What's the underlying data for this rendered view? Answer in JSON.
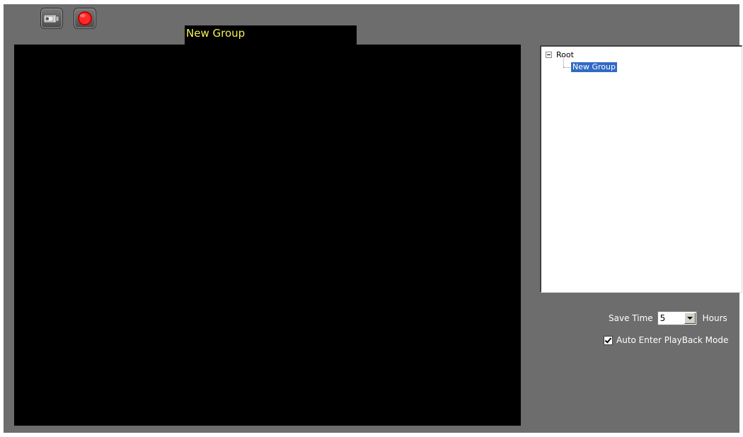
{
  "toolbar": {
    "camera_icon": "camera-icon",
    "record_icon": "record-icon"
  },
  "video": {
    "group_tab_label": "New Group"
  },
  "tree": {
    "root_label": "Root",
    "child_label": "New Group",
    "selected_color": "#316ac5"
  },
  "settings": {
    "save_time_label": "Save Time",
    "save_time_value": "5",
    "save_time_unit": "Hours",
    "auto_playback_label": "Auto Enter PlayBack Mode",
    "auto_playback_checked": true
  },
  "colors": {
    "window_bg": "#6d6d6d",
    "tab_text": "#f2f25a"
  }
}
